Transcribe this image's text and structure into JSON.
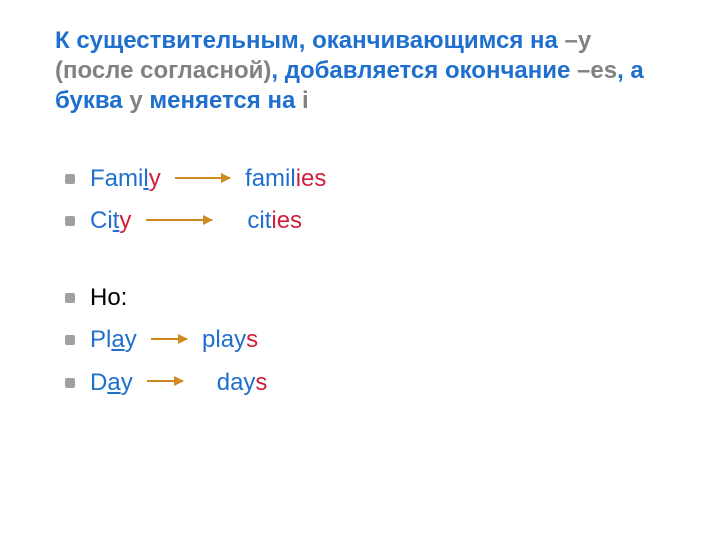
{
  "title": {
    "seg1": "К существительным, оканчивающимся на ",
    "seg2": "–у (после согласной)",
    "seg3": ", добавляется окончание ",
    "seg4": "–es",
    "seg5": ", а буква ",
    "seg6": "у",
    "seg7": " меняется на ",
    "seg8": "i"
  },
  "rows": {
    "family": {
      "w1_pre": "Fami",
      "w1_u": "l",
      "w1_y": "y",
      "arrow_w": 55,
      "w2_pre": "famil",
      "w2_suf": "ies"
    },
    "city": {
      "w1_pre": "Ci",
      "w1_u": "t",
      "w1_y": "y",
      "arrow_w": 66,
      "gap_w": 14,
      "w2_pre": "cit",
      "w2_suf": "ies"
    },
    "but": {
      "label": "Но:"
    },
    "play": {
      "w1_pre": "Pl",
      "w1_u": "a",
      "w1_y": "y",
      "arrow_w": 36,
      "w2_pre": "play",
      "w2_suf": "s"
    },
    "day": {
      "w1_pre": "D",
      "w1_u": "a",
      "w1_y": "y",
      "arrow_w": 36,
      "gap_w": 12,
      "w2_pre": "day",
      "w2_suf": "s"
    }
  }
}
